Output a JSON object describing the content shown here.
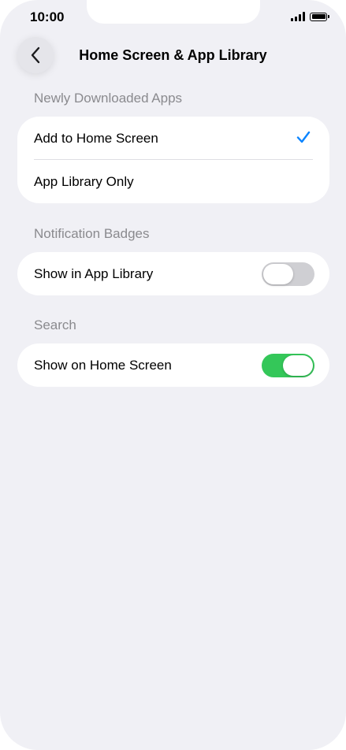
{
  "status_bar": {
    "time": "10:00",
    "signal_icon": "cellular-signal-icon",
    "battery_icon": "battery-full-icon"
  },
  "nav": {
    "back_icon": "chevron-left-icon",
    "title": "Home Screen & App Library"
  },
  "sections": {
    "newly_downloaded": {
      "header": "Newly Downloaded Apps",
      "options": [
        {
          "label": "Add to Home Screen",
          "selected": true
        },
        {
          "label": "App Library Only",
          "selected": false
        }
      ]
    },
    "notification_badges": {
      "header": "Notification Badges",
      "row": {
        "label": "Show in App Library",
        "toggle": "off"
      }
    },
    "search": {
      "header": "Search",
      "row": {
        "label": "Show on Home Screen",
        "toggle": "on"
      }
    }
  },
  "colors": {
    "background": "#f0f0f5",
    "accent_check": "#0a84ff",
    "toggle_on": "#34c759",
    "toggle_off": "#cfcfd3",
    "section_header": "#8a8a8e"
  }
}
